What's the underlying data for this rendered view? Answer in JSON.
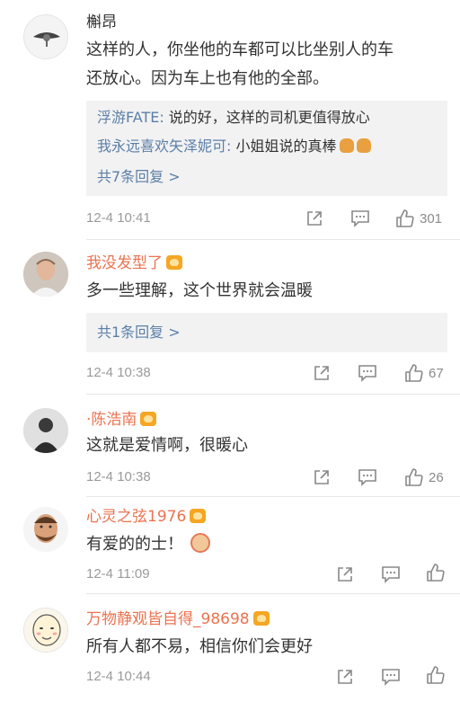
{
  "comments": [
    {
      "username": "槲昂",
      "text_line1": "这样的人，你坐他的车都可以比坐别人的车",
      "text_line2": "还放心。因为车上也有他的全部。",
      "replies": [
        {
          "user": "浮游FATE:",
          "text": " 说的好，这样的司机更值得放心"
        },
        {
          "user": "我永远喜欢矢泽妮可:",
          "text": " 小姐姐说的真棒"
        }
      ],
      "more_replies": "共7条回复 >",
      "time": "12-4 10:41",
      "likes": "301"
    },
    {
      "username": "我没发型了",
      "text": "多一些理解，这个世界就会温暖",
      "more_replies": "共1条回复 >",
      "time": "12-4 10:38",
      "likes": "67"
    },
    {
      "username": "·陈浩南",
      "text": "这就是爱情啊，很暖心",
      "time": "12-4 10:38",
      "likes": "26"
    },
    {
      "username": "心灵之弦1976",
      "text": "有爱的的士！",
      "time": "12-4 11:09",
      "likes": ""
    },
    {
      "username": "万物静观皆自得_98698",
      "text": "所有人都不易，相信你们会更好",
      "time": "12-4 10:44",
      "likes": ""
    }
  ],
  "colors": {
    "link": "#5b7fa8",
    "vip_name": "#eb7350",
    "time": "#9a9a9a",
    "reply_bg": "#f2f2f2"
  },
  "icons": {
    "share": "share-icon",
    "comment": "comment-icon",
    "like": "thumbs-up-icon"
  }
}
